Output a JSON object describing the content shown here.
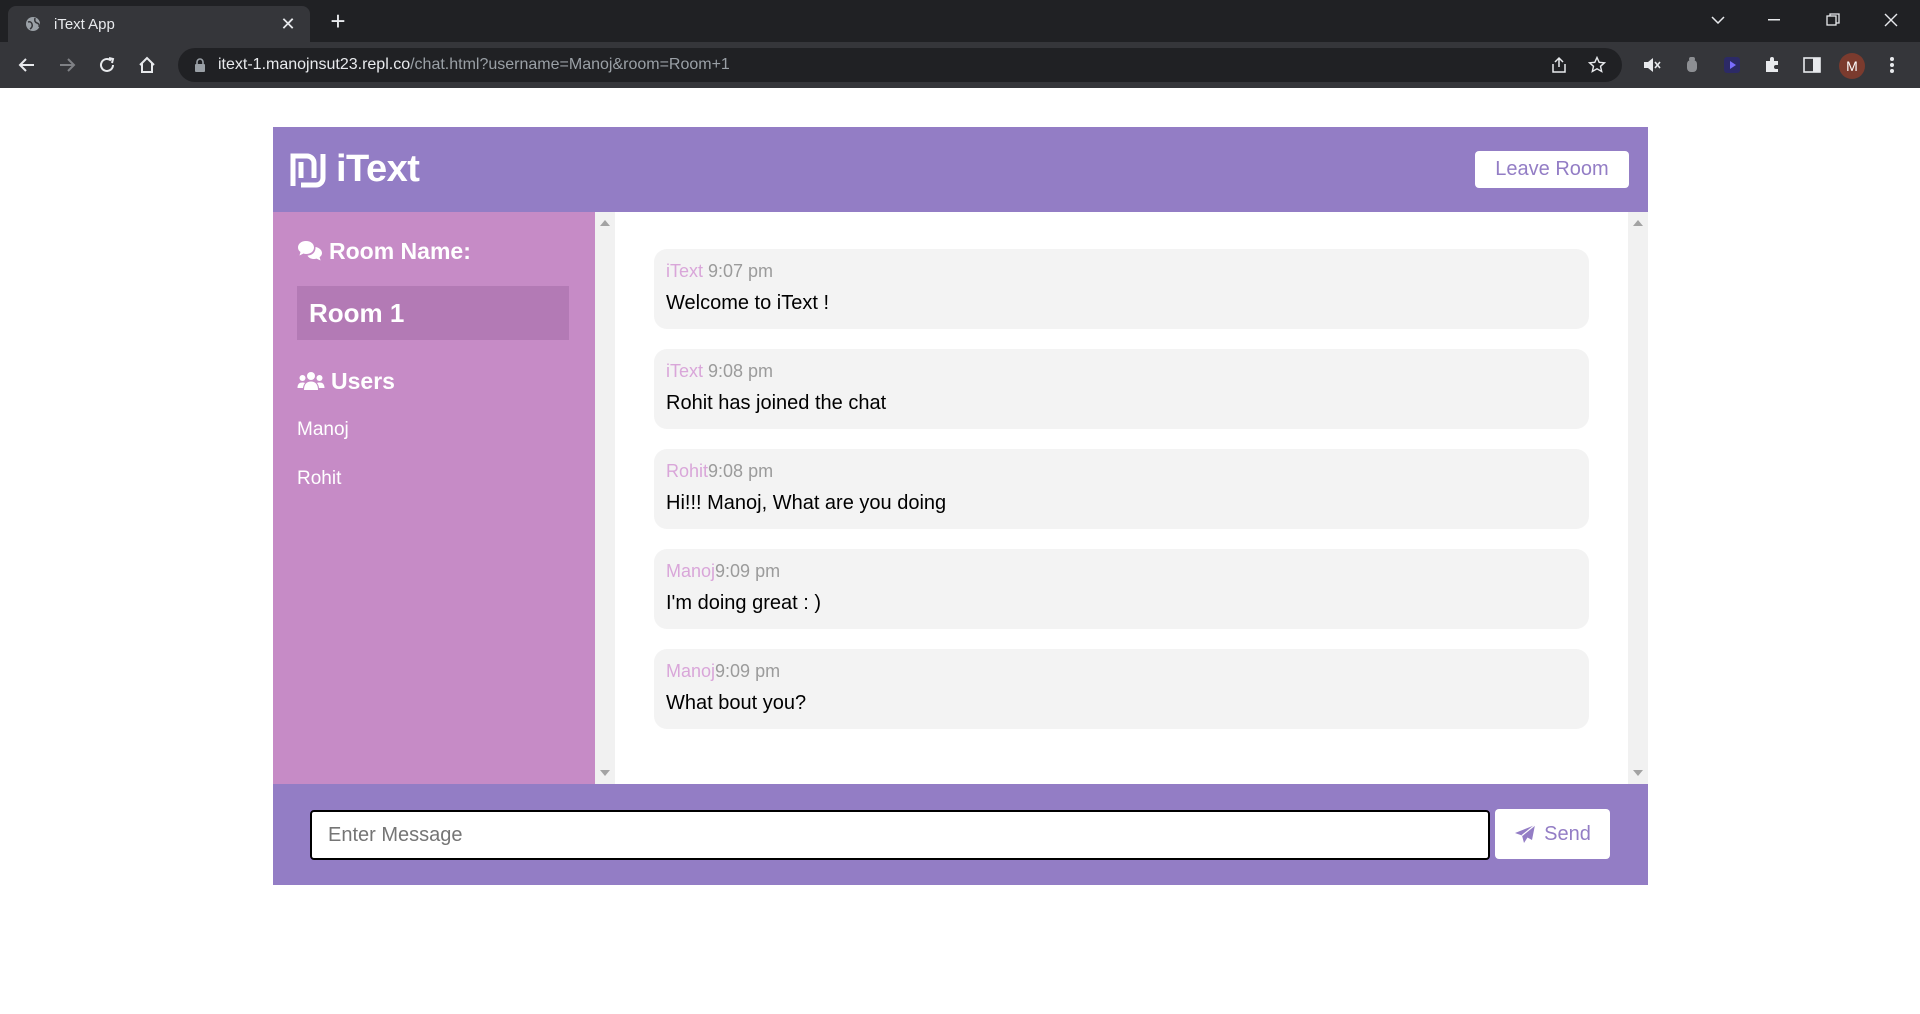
{
  "browser": {
    "tab_title": "iText App",
    "url_host": "itext-1.manojnsut23.repl.co",
    "url_path": "/chat.html?username=Manoj&room=Room+1",
    "profile_initial": "M"
  },
  "app": {
    "brand": "iText",
    "leave_button": "Leave Room",
    "room_heading": "Room Name:",
    "room_name": "Room 1",
    "users_heading": "Users",
    "users": [
      "Manoj",
      "Rohit"
    ],
    "messages": [
      {
        "sender": "iText",
        "time": " 9:07 pm",
        "text": "Welcome to iText !"
      },
      {
        "sender": "iText",
        "time": " 9:08 pm",
        "text": "Rohit has joined the chat"
      },
      {
        "sender": "Rohit",
        "time": "9:08 pm",
        "text": "Hi!!! Manoj, What are you doing"
      },
      {
        "sender": "Manoj",
        "time": "9:09 pm",
        "text": "I'm doing great : )"
      },
      {
        "sender": "Manoj",
        "time": "9:09 pm",
        "text": "What bout you?"
      }
    ],
    "input_placeholder": "Enter Message",
    "send_button": "Send"
  },
  "colors": {
    "header": "#937dc5",
    "sidebar": "#c68bc6",
    "room_highlight": "#b37ab5",
    "sender": "#d9a6d9"
  }
}
